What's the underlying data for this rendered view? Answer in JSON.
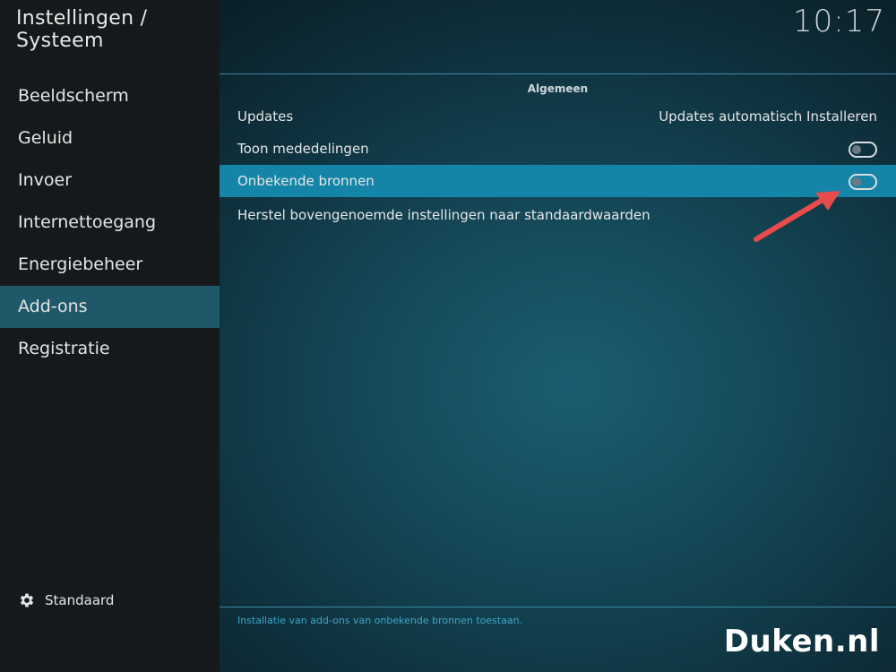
{
  "header": {
    "title": "Instellingen / Systeem",
    "clock": "10:17"
  },
  "sidebar": {
    "items": [
      {
        "label": "Beeldscherm"
      },
      {
        "label": "Geluid"
      },
      {
        "label": "Invoer"
      },
      {
        "label": "Internettoegang"
      },
      {
        "label": "Energiebeheer"
      },
      {
        "label": "Add-ons",
        "active": true
      },
      {
        "label": "Registratie"
      }
    ],
    "level_label": "Standaard"
  },
  "main": {
    "section_title": "Algemeen",
    "rows": [
      {
        "label": "Updates",
        "value": "Updates automatisch Installeren"
      },
      {
        "label": "Toon mededelingen",
        "toggle": "off"
      },
      {
        "label": "Onbekende bronnen",
        "toggle": "off",
        "focused": true
      },
      {
        "label": "Herstel bovengenoemde instellingen naar standaardwaarden"
      }
    ],
    "hint": "Installatie van add-ons van onbekende bronnen toestaan."
  },
  "watermark": "Duken.nl",
  "colors": {
    "accent": "#1485a8",
    "active_menu": "#1f5868",
    "arrow": "#e84b4b"
  },
  "icons": {
    "standaard": "gear-icon",
    "annotation": "arrow-annotation"
  }
}
